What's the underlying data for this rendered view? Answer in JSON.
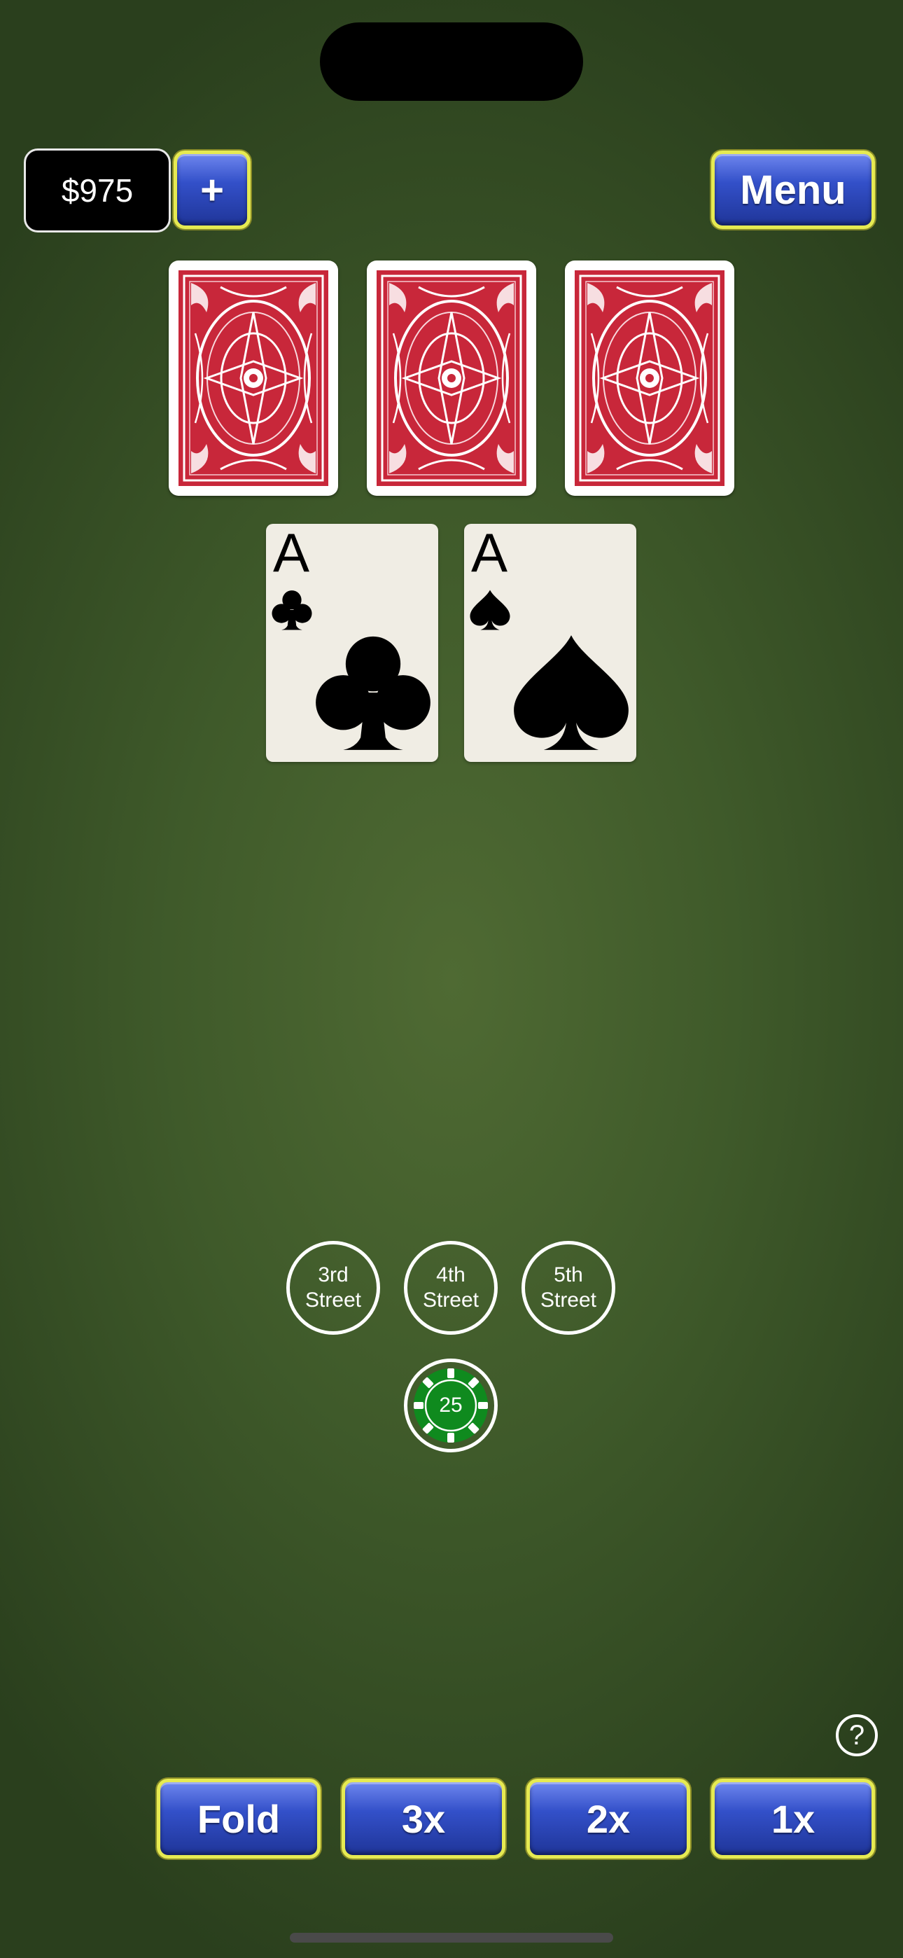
{
  "header": {
    "balance": "$975",
    "add_funds_label": "+",
    "menu_label": "Menu"
  },
  "dealer_cards": [
    {
      "face": "down"
    },
    {
      "face": "down"
    },
    {
      "face": "down"
    }
  ],
  "player_cards": [
    {
      "rank": "A",
      "suit": "clubs"
    },
    {
      "rank": "A",
      "suit": "spades"
    }
  ],
  "bet_spots": [
    {
      "line1": "3rd",
      "line2": "Street"
    },
    {
      "line1": "4th",
      "line2": "Street"
    },
    {
      "line1": "5th",
      "line2": "Street"
    }
  ],
  "ante_chip": {
    "value": "25",
    "color": "#0f8a1e"
  },
  "help_label": "?",
  "actions": {
    "fold": "Fold",
    "bet_3x": "3x",
    "bet_2x": "2x",
    "bet_1x": "1x"
  },
  "colors": {
    "table_felt": "#4f6a33",
    "button_blue": "#3350c9",
    "button_border": "#e6ea52",
    "card_back_red": "#c8273a"
  }
}
